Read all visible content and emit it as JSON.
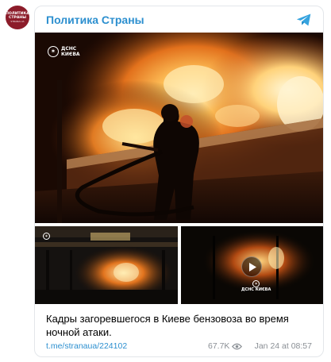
{
  "channel": {
    "name": "Политика Страны",
    "avatar_line1": "ПОЛИТИКА",
    "avatar_line2": "СТРАНЫ",
    "avatar_domain": "STRANA.UA",
    "avatar_color": "#8c1c2a",
    "name_color": "#2c8fcf"
  },
  "media": {
    "watermark_line1": "ДСНС",
    "watermark_line2": "КИЄВА",
    "main_alt": "night fire scene with firefighter",
    "left_alt": "gas station burning",
    "right_alt": "video frame of fire"
  },
  "post": {
    "caption": "Кадры загоревшегося в Киеве бензовоза во время ночной атаки.",
    "link": "t.me/stranaua/224102",
    "views": "67.7K",
    "date": "Jan 24 at 08:57"
  },
  "icons": {
    "telegram": "telegram-icon",
    "eye": "eye-icon",
    "play": "play-icon"
  }
}
